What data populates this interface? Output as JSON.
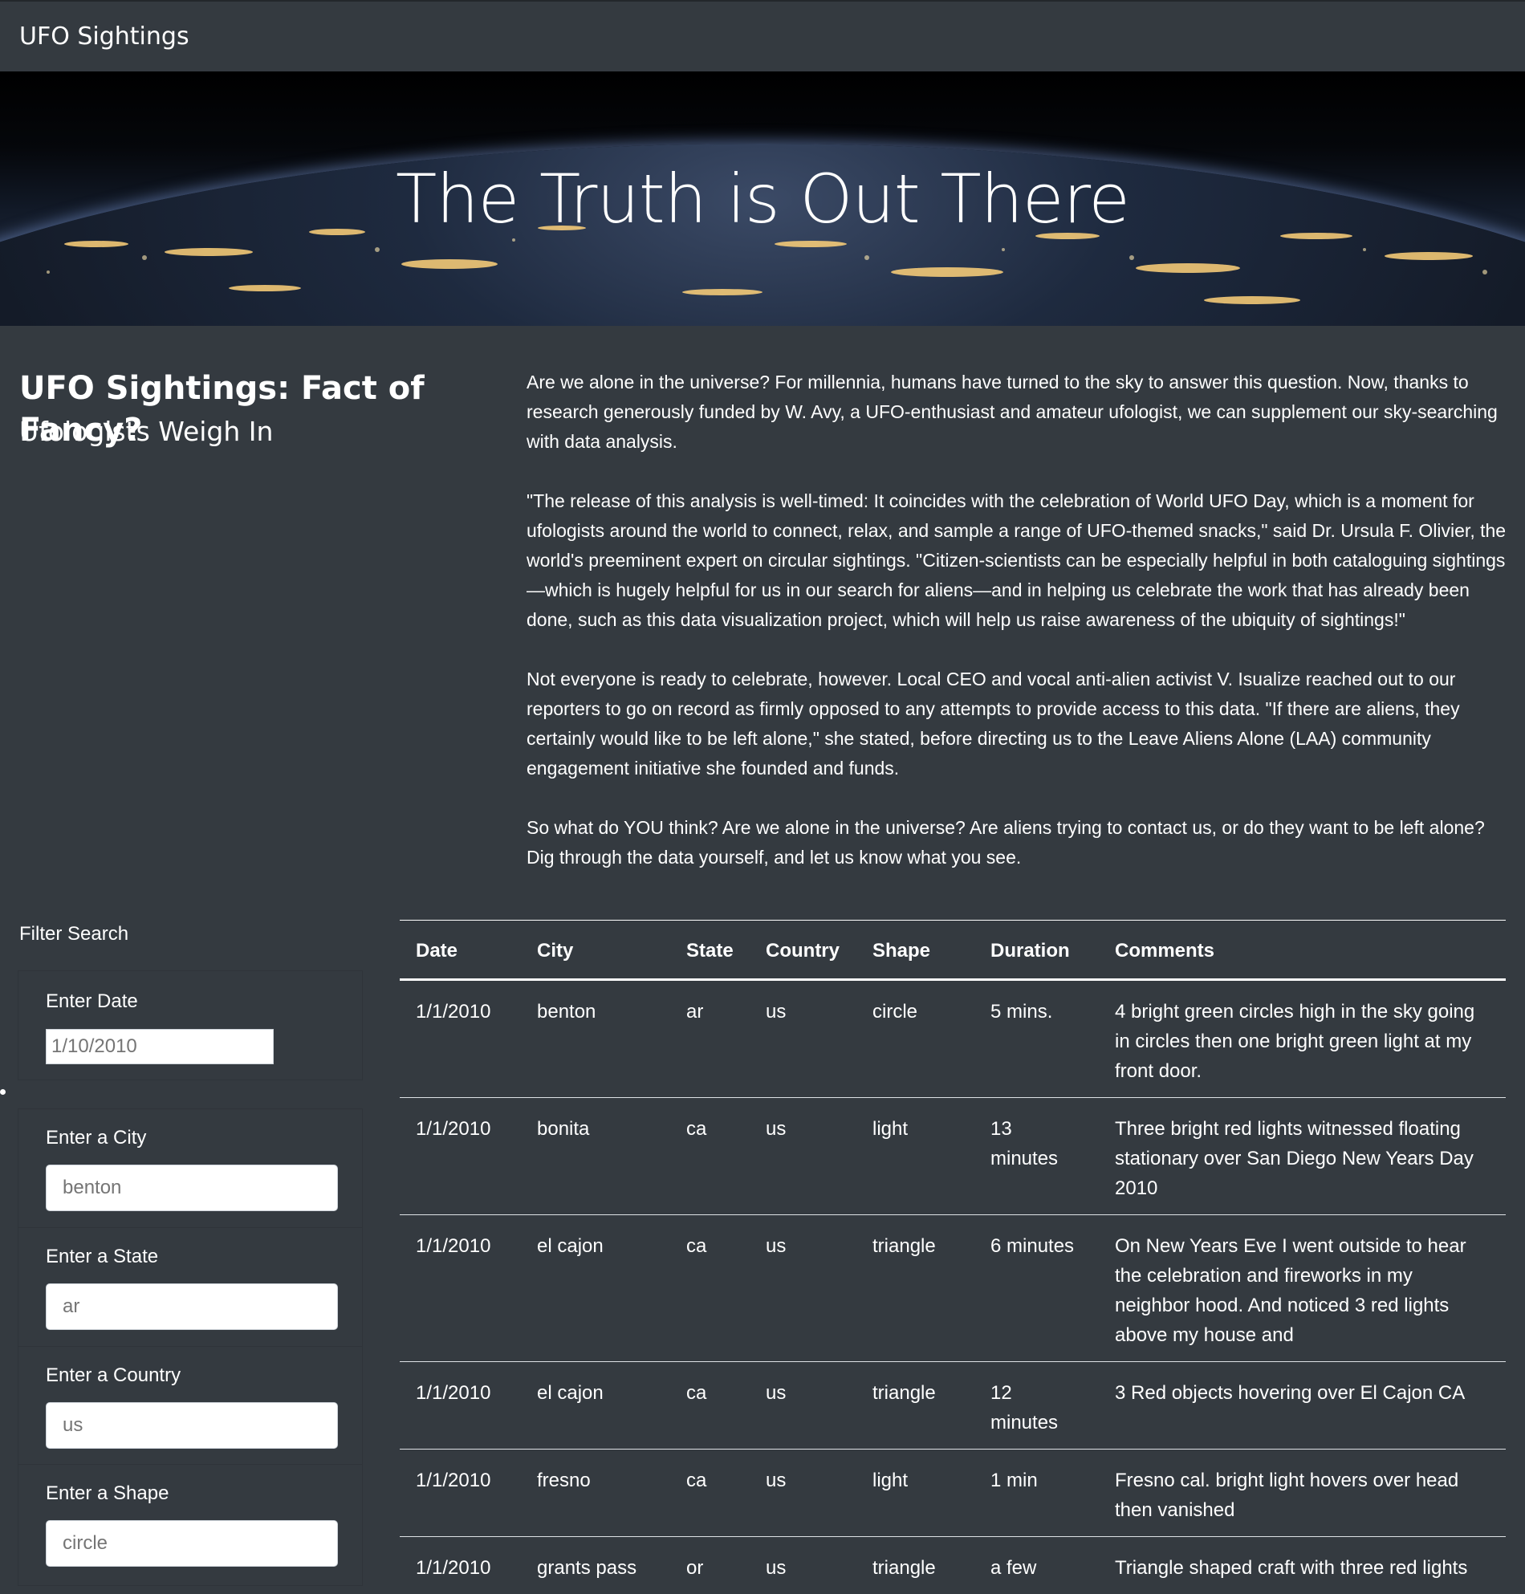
{
  "navbar": {
    "brand": "UFO Sightings"
  },
  "hero": {
    "title": "The Truth is Out There"
  },
  "intro": {
    "heading": "UFO Sightings: Fact of Fancy?",
    "subheading": "Ufologists Weigh In",
    "paragraphs": [
      "Are we alone in the universe? For millennia, humans have turned to the sky to answer this question. Now, thanks to research generously funded by W. Avy, a UFO-enthusiast and amateur ufologist, we can supplement our sky-searching with data analysis.",
      "\"The release of this analysis is well-timed: It coincides with the celebration of World UFO Day, which is a moment for ufologists around the world to connect, relax, and sample a range of UFO-themed snacks,\" said Dr. Ursula F. Olivier, the world's preeminent expert on circular sightings. \"Citizen-scientists can be especially helpful in both cataloguing sightings—which is hugely helpful for us in our search for aliens—and in helping us celebrate the work that has already been done, such as this data visualization project, which will help us raise awareness of the ubiquity of sightings!\"",
      "Not everyone is ready to celebrate, however. Local CEO and vocal anti-alien activist V. Isualize reached out to our reporters to go on record as firmly opposed to any attempts to provide access to this data. \"If there are aliens, they certainly would like to be left alone,\" she stated, before directing us to the Leave Aliens Alone (LAA) community engagement initiative she founded and funds.",
      "So what do YOU think? Are we alone in the universe? Are aliens trying to contact us, or do they want to be left alone? Dig through the data yourself, and let us know what you see."
    ]
  },
  "filters": {
    "title": "Filter Search",
    "date": {
      "label": "Enter Date",
      "placeholder": "1/10/2010"
    },
    "city": {
      "label": "Enter a City",
      "placeholder": "benton"
    },
    "state": {
      "label": "Enter a State",
      "placeholder": "ar"
    },
    "country": {
      "label": "Enter a Country",
      "placeholder": "us"
    },
    "shape": {
      "label": "Enter a Shape",
      "placeholder": "circle"
    }
  },
  "table": {
    "headers": [
      "Date",
      "City",
      "State",
      "Country",
      "Shape",
      "Duration",
      "Comments"
    ],
    "rows": [
      [
        "1/1/2010",
        "benton",
        "ar",
        "us",
        "circle",
        "5 mins.",
        "4 bright green circles high in the sky going in circles then one bright green light at my front door."
      ],
      [
        "1/1/2010",
        "bonita",
        "ca",
        "us",
        "light",
        "13 minutes",
        "Three bright red lights witnessed floating stationary over San Diego New Years Day 2010"
      ],
      [
        "1/1/2010",
        "el cajon",
        "ca",
        "us",
        "triangle",
        "6 minutes",
        "On New Years Eve I went outside to hear the celebration and fireworks in my neighbor hood. And noticed 3 red lights above my house and"
      ],
      [
        "1/1/2010",
        "el cajon",
        "ca",
        "us",
        "triangle",
        "12 minutes",
        "3 Red objects hovering over El Cajon CA"
      ],
      [
        "1/1/2010",
        "fresno",
        "ca",
        "us",
        "light",
        "1 min",
        "Fresno cal. bright light hovers over head then vanished"
      ],
      [
        "1/1/2010",
        "grants pass",
        "or",
        "us",
        "triangle",
        "a few",
        "Triangle shaped craft with three red lights"
      ]
    ]
  }
}
